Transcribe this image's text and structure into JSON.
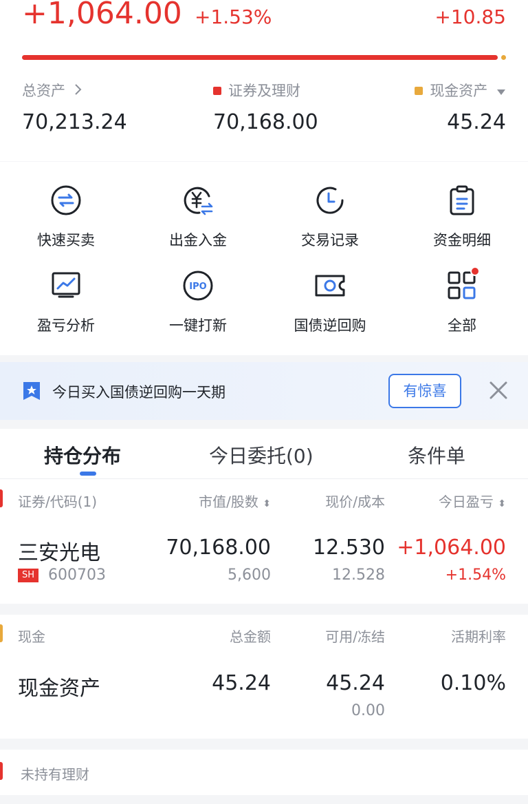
{
  "summary": {
    "day_pnl": "+1,064.00",
    "day_pnl_pct": "+1.53%",
    "right_change": "+10.85",
    "progress_fraction": 0.994,
    "total_assets_label": "总资产",
    "total_assets_value": "70,213.24",
    "securities_label": "证券及理财",
    "securities_value": "70,168.00",
    "cash_label": "现金资产",
    "cash_value": "45.24",
    "colors": {
      "red": "#e5332e",
      "gold": "#e8a93c",
      "blue": "#3b78e7"
    }
  },
  "actions": [
    {
      "label": "快速买卖",
      "icon": "swap-arrows-icon"
    },
    {
      "label": "出金入金",
      "icon": "yen-transfer-icon"
    },
    {
      "label": "交易记录",
      "icon": "clock-icon"
    },
    {
      "label": "资金明细",
      "icon": "clipboard-icon"
    },
    {
      "label": "盈亏分析",
      "icon": "chart-monitor-icon"
    },
    {
      "label": "一键打新",
      "icon": "ipo-icon"
    },
    {
      "label": "国债逆回购",
      "icon": "bond-ticket-icon"
    },
    {
      "label": "全部",
      "icon": "grid-apps-icon"
    }
  ],
  "banner": {
    "text": "今日买入国债逆回购一天期",
    "button": "有惊喜"
  },
  "tabs": [
    {
      "label": "持仓分布",
      "active": true
    },
    {
      "label": "今日委托(0)",
      "active": false
    },
    {
      "label": "条件单",
      "active": false
    }
  ],
  "positions": {
    "headers": [
      "证券/代码(1)",
      "市值/股数",
      "现价/成本",
      "今日盈亏"
    ],
    "rows": [
      {
        "name": "三安光电",
        "market": "SH",
        "code": "600703",
        "market_value": "70,168.00",
        "shares": "5,600",
        "price": "12.530",
        "cost": "12.528",
        "pnl": "+1,064.00",
        "pnl_pct": "+1.54%"
      }
    ]
  },
  "cash": {
    "headers": [
      "现金",
      "总金额",
      "可用/冻结",
      "活期利率"
    ],
    "name": "现金资产",
    "total": "45.24",
    "available": "45.24",
    "frozen": "0.00",
    "rate": "0.10%"
  },
  "wealth": {
    "label": "未持有理财"
  }
}
